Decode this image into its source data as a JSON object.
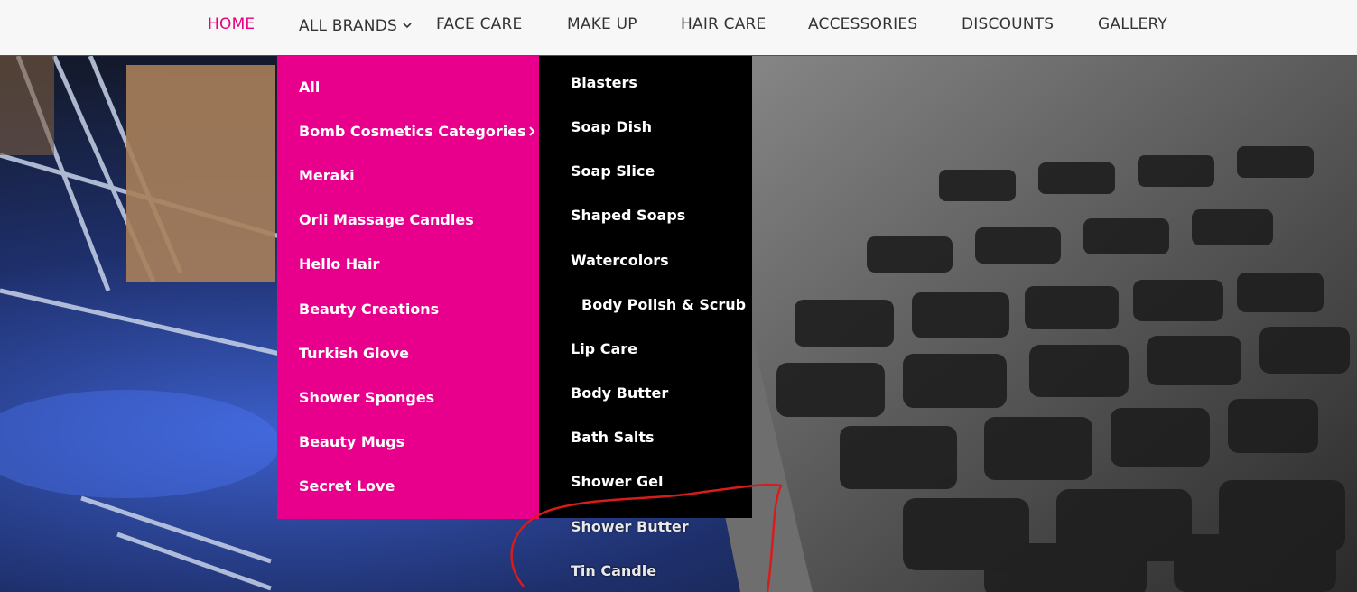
{
  "nav": {
    "items": [
      {
        "label": "HOME",
        "active": true
      },
      {
        "label": "ALL BRANDS",
        "has_dropdown": true,
        "icon": "chevron-down-icon"
      },
      {
        "label": "FACE CARE"
      },
      {
        "label": "MAKE UP"
      },
      {
        "label": "HAIR CARE"
      },
      {
        "label": "ACCESSORIES"
      },
      {
        "label": "DISCOUNTS"
      },
      {
        "label": "GALLERY"
      }
    ]
  },
  "brands_menu": {
    "items": [
      {
        "label": "All"
      },
      {
        "label": "Bomb Cosmetics Categories",
        "has_submenu": true,
        "icon": "chevron-right-icon"
      },
      {
        "label": "Meraki"
      },
      {
        "label": "Orli Massage Candles"
      },
      {
        "label": "Hello Hair"
      },
      {
        "label": "Beauty Creations"
      },
      {
        "label": "Turkish Glove"
      },
      {
        "label": "Shower Sponges"
      },
      {
        "label": "Beauty Mugs"
      },
      {
        "label": "Secret Love"
      }
    ]
  },
  "bomb_submenu": {
    "items": [
      {
        "label": "Blasters"
      },
      {
        "label": "Soap Dish"
      },
      {
        "label": "Soap Slice"
      },
      {
        "label": "Shaped Soaps"
      },
      {
        "label": "Watercolors"
      },
      {
        "label": "Body Polish & Scrub"
      },
      {
        "label": "Lip Care"
      },
      {
        "label": "Body Butter"
      },
      {
        "label": "Bath Salts"
      },
      {
        "label": "Shower Gel"
      },
      {
        "label": "Shower Butter"
      },
      {
        "label": "Tin Candle"
      }
    ]
  },
  "colors": {
    "accent": "#e6007e",
    "submenu_bg": "#000000",
    "nav_bg": "#f7f7f7",
    "annotation": "#d81b1b"
  }
}
